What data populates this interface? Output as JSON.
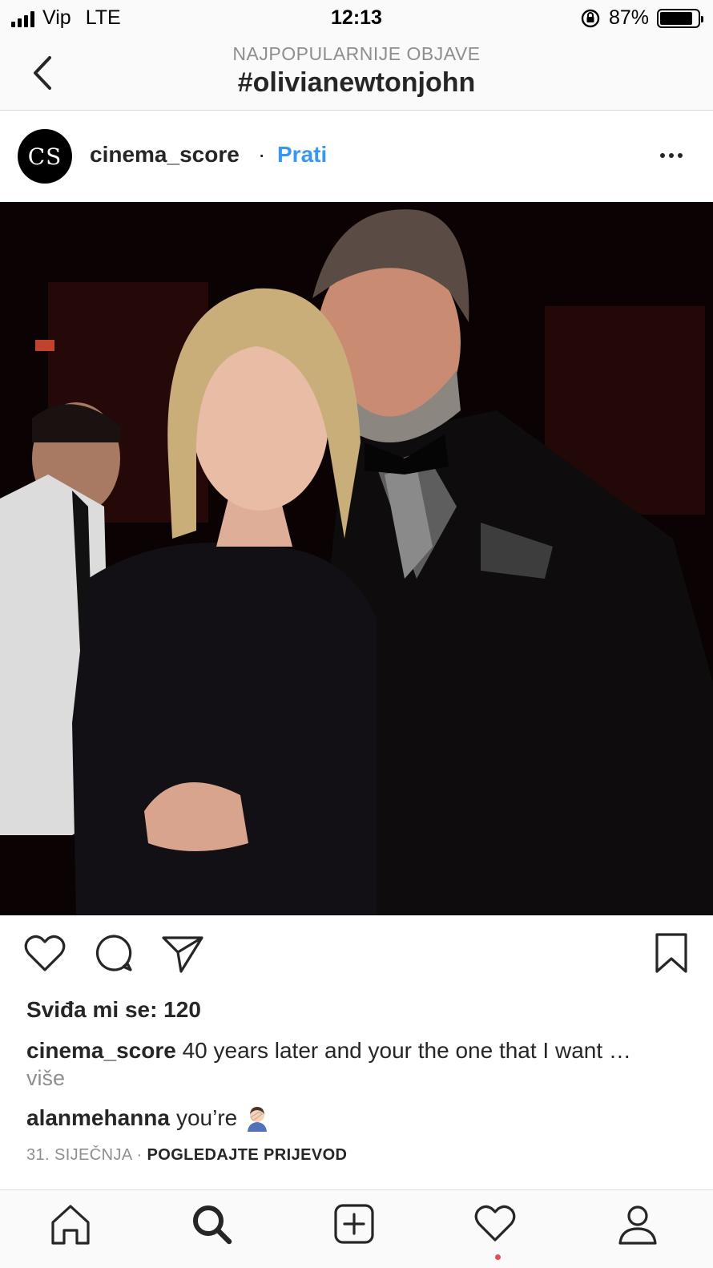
{
  "status_bar": {
    "carrier": "Vip",
    "network": "LTE",
    "time": "12:13",
    "battery": "87%",
    "battery_level": 0.87
  },
  "header": {
    "subtitle": "NAJPOPULARNIJE OBJAVE",
    "title": "#olivianewtonjohn"
  },
  "post": {
    "avatar_text": "CS",
    "username": "cinema_score",
    "separator": "·",
    "follow_label": "Prati",
    "likes": "Sviđa mi se: 120",
    "caption_user": "cinema_score",
    "caption_text": "40 years later and your the one that I want …",
    "more_label": "više",
    "comment_user": "alanmehanna",
    "comment_text": "you’re",
    "date": "31. SIJEČNJA",
    "meta_separator": " · ",
    "translate_label": "POGLEDAJTE PRIJEVOD"
  },
  "colors": {
    "link_blue": "#3897f0",
    "text": "#262626",
    "muted": "#8e8e8e",
    "notification": "#ed4956"
  },
  "icons": {
    "back": "chevron-left-icon",
    "more": "more-horizontal-icon",
    "like": "heart-icon",
    "comment": "comment-icon",
    "share": "paper-plane-icon",
    "save": "bookmark-icon",
    "home": "home-icon",
    "search": "search-icon",
    "add": "plus-square-icon",
    "activity": "heart-icon",
    "profile": "user-icon"
  }
}
